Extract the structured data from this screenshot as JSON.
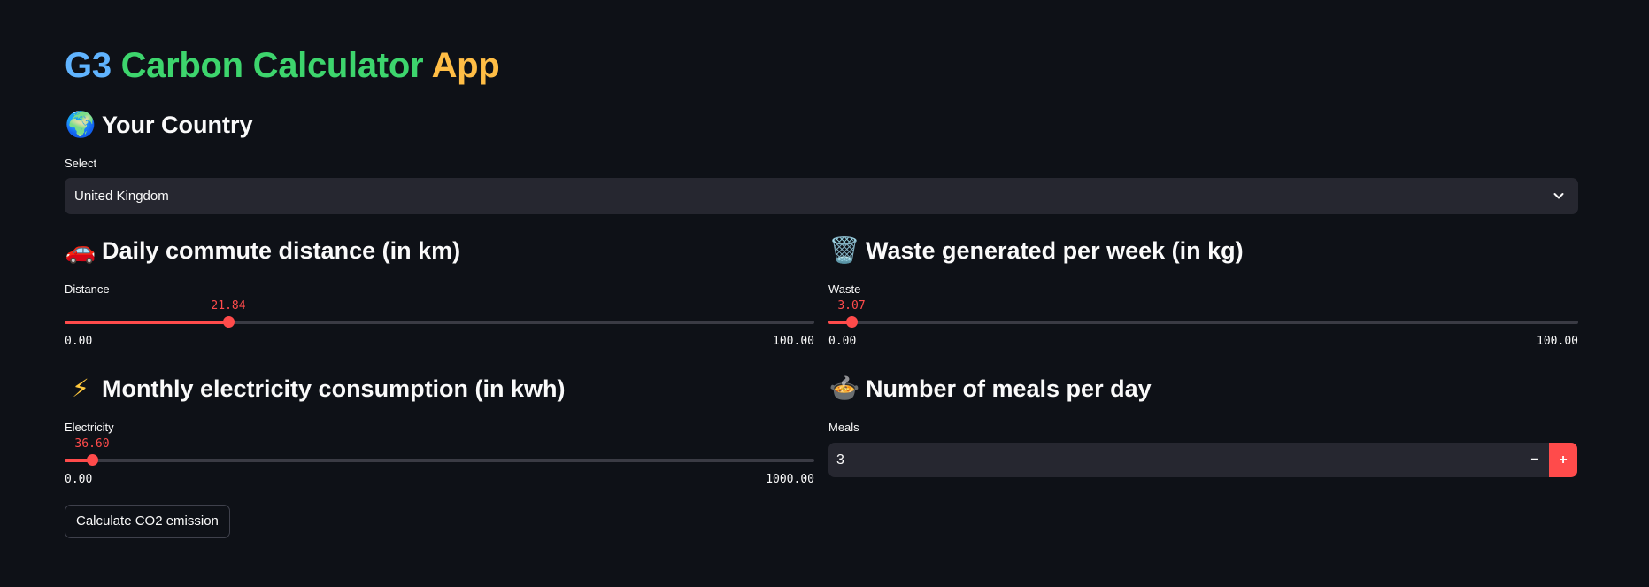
{
  "title": {
    "part1": "G3",
    "part2": "Carbon Calculator",
    "part3": "App"
  },
  "colors": {
    "background": "#0e1117",
    "accent": "#ff4b4b",
    "title_blue": "#60b4ff",
    "title_green": "#3dd56d",
    "title_orange": "#ffbd45",
    "input_bg": "#262730"
  },
  "country": {
    "icon": "globe-icon",
    "heading": "Your Country",
    "label": "Select",
    "selected": "United Kingdom"
  },
  "distance": {
    "icon": "car-icon",
    "heading": "Daily commute distance (in km)",
    "label": "Distance",
    "value": "21.84",
    "min": "0.00",
    "max": "100.00",
    "fraction": 0.2184
  },
  "waste": {
    "icon": "wastebasket-icon",
    "heading": "Waste generated per week (in kg)",
    "label": "Waste",
    "value": "3.07",
    "min": "0.00",
    "max": "100.00",
    "fraction": 0.0307
  },
  "electricity": {
    "icon": "lightning-icon",
    "heading": "Monthly electricity consumption (in kwh)",
    "label": "Electricity",
    "value": "36.60",
    "min": "0.00",
    "max": "1000.00",
    "fraction": 0.0366
  },
  "meals": {
    "icon": "stew-pot-icon",
    "heading": "Number of meals per day",
    "label": "Meals",
    "value": "3",
    "minus": "−",
    "plus": "+"
  },
  "calculate_button": "Calculate CO2 emission"
}
